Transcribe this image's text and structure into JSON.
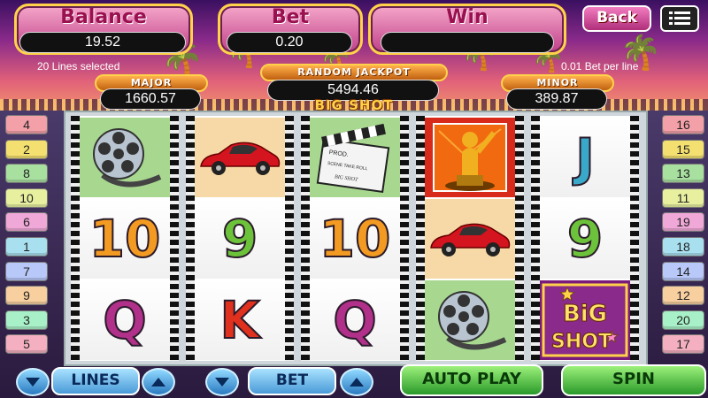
{
  "meters": {
    "balance_label": "Balance",
    "balance_value": "19.52",
    "bet_label": "Bet",
    "bet_value": "0.20",
    "win_label": "Win",
    "win_value": ""
  },
  "info": {
    "lines_selected": "20 Lines selected",
    "bet_per_line": "0.01 Bet per line"
  },
  "jackpots": {
    "major_label": "MAJOR",
    "major_value": "1660.57",
    "random_label": "RANDOM JACKPOT",
    "random_value": "5494.46",
    "minor_label": "MINOR",
    "minor_value": "389.87"
  },
  "game_title": "BIG SHOT",
  "buttons": {
    "back_label": "Back",
    "lines_label": "LINES",
    "bet_label": "BET",
    "autoplay_label": "AUTO PLAY",
    "spin_label": "SPIN"
  },
  "left_lines": [
    "4",
    "2",
    "8",
    "10",
    "6",
    "1",
    "7",
    "9",
    "3",
    "5"
  ],
  "right_lines": [
    "16",
    "15",
    "13",
    "11",
    "19",
    "18",
    "14",
    "12",
    "20",
    "17"
  ],
  "line_colors": [
    "#f4a0a8",
    "#f4e070",
    "#a8e0a0",
    "#e8f0a0",
    "#f0a8d8",
    "#a8e0f0",
    "#b8c8f8",
    "#f8d0a0",
    "#a8f0c8",
    "#f4b0c0"
  ],
  "reels": [
    [
      "film-reel",
      "ten",
      "queen"
    ],
    [
      "sports-car",
      "nine",
      "king"
    ],
    [
      "clapperboard",
      "ten",
      "queen"
    ],
    [
      "oscar-statue",
      "sports-car",
      "film-reel"
    ],
    [
      "jack",
      "nine",
      "big-shot"
    ]
  ],
  "symbol_text": {
    "ten": "10",
    "nine": "9",
    "queen": "Q",
    "king": "K",
    "jack": "J",
    "big_shot_line1": "BiG",
    "big_shot_line2": "SHOT",
    "clapper_line1": "PROD.",
    "clapper_line2": "SCENE  TAKE  ROLL",
    "clapper_sign": "BIG SHOT"
  },
  "colors": {
    "meter_gold": "#ffd24a",
    "spin_green": "#2a9a2a",
    "control_blue": "#4a9ad8"
  }
}
